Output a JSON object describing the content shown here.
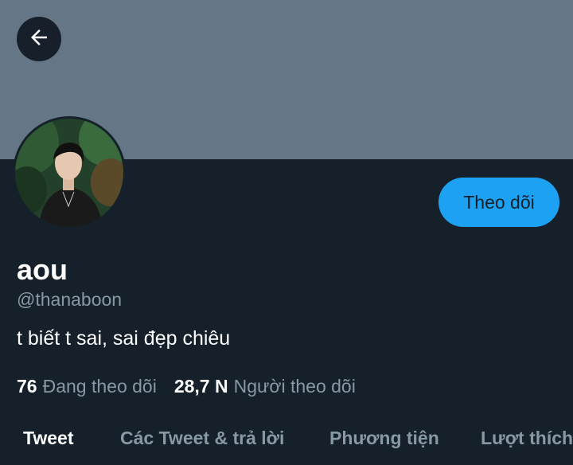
{
  "colors": {
    "background": "#15202b",
    "banner": "#657786",
    "accent": "#1da1f2",
    "secondary_text": "#8899a6",
    "primary_text": "#ffffff"
  },
  "header": {
    "back_icon": "arrow-left-icon"
  },
  "profile": {
    "display_name": "aou",
    "handle": "@thanaboon",
    "bio": "t biết t sai, sai đẹp chiêu",
    "follow_label": "Theo dõi"
  },
  "stats": {
    "following_count": "76",
    "following_label": "Đang theo dõi",
    "followers_count": "28,7 N",
    "followers_label": "Người theo dõi"
  },
  "tabs": [
    {
      "label": "Tweet",
      "active": true
    },
    {
      "label": "Các Tweet & trả lời",
      "active": false
    },
    {
      "label": "Phương tiện",
      "active": false
    },
    {
      "label": "Lượt thích",
      "active": false
    }
  ]
}
